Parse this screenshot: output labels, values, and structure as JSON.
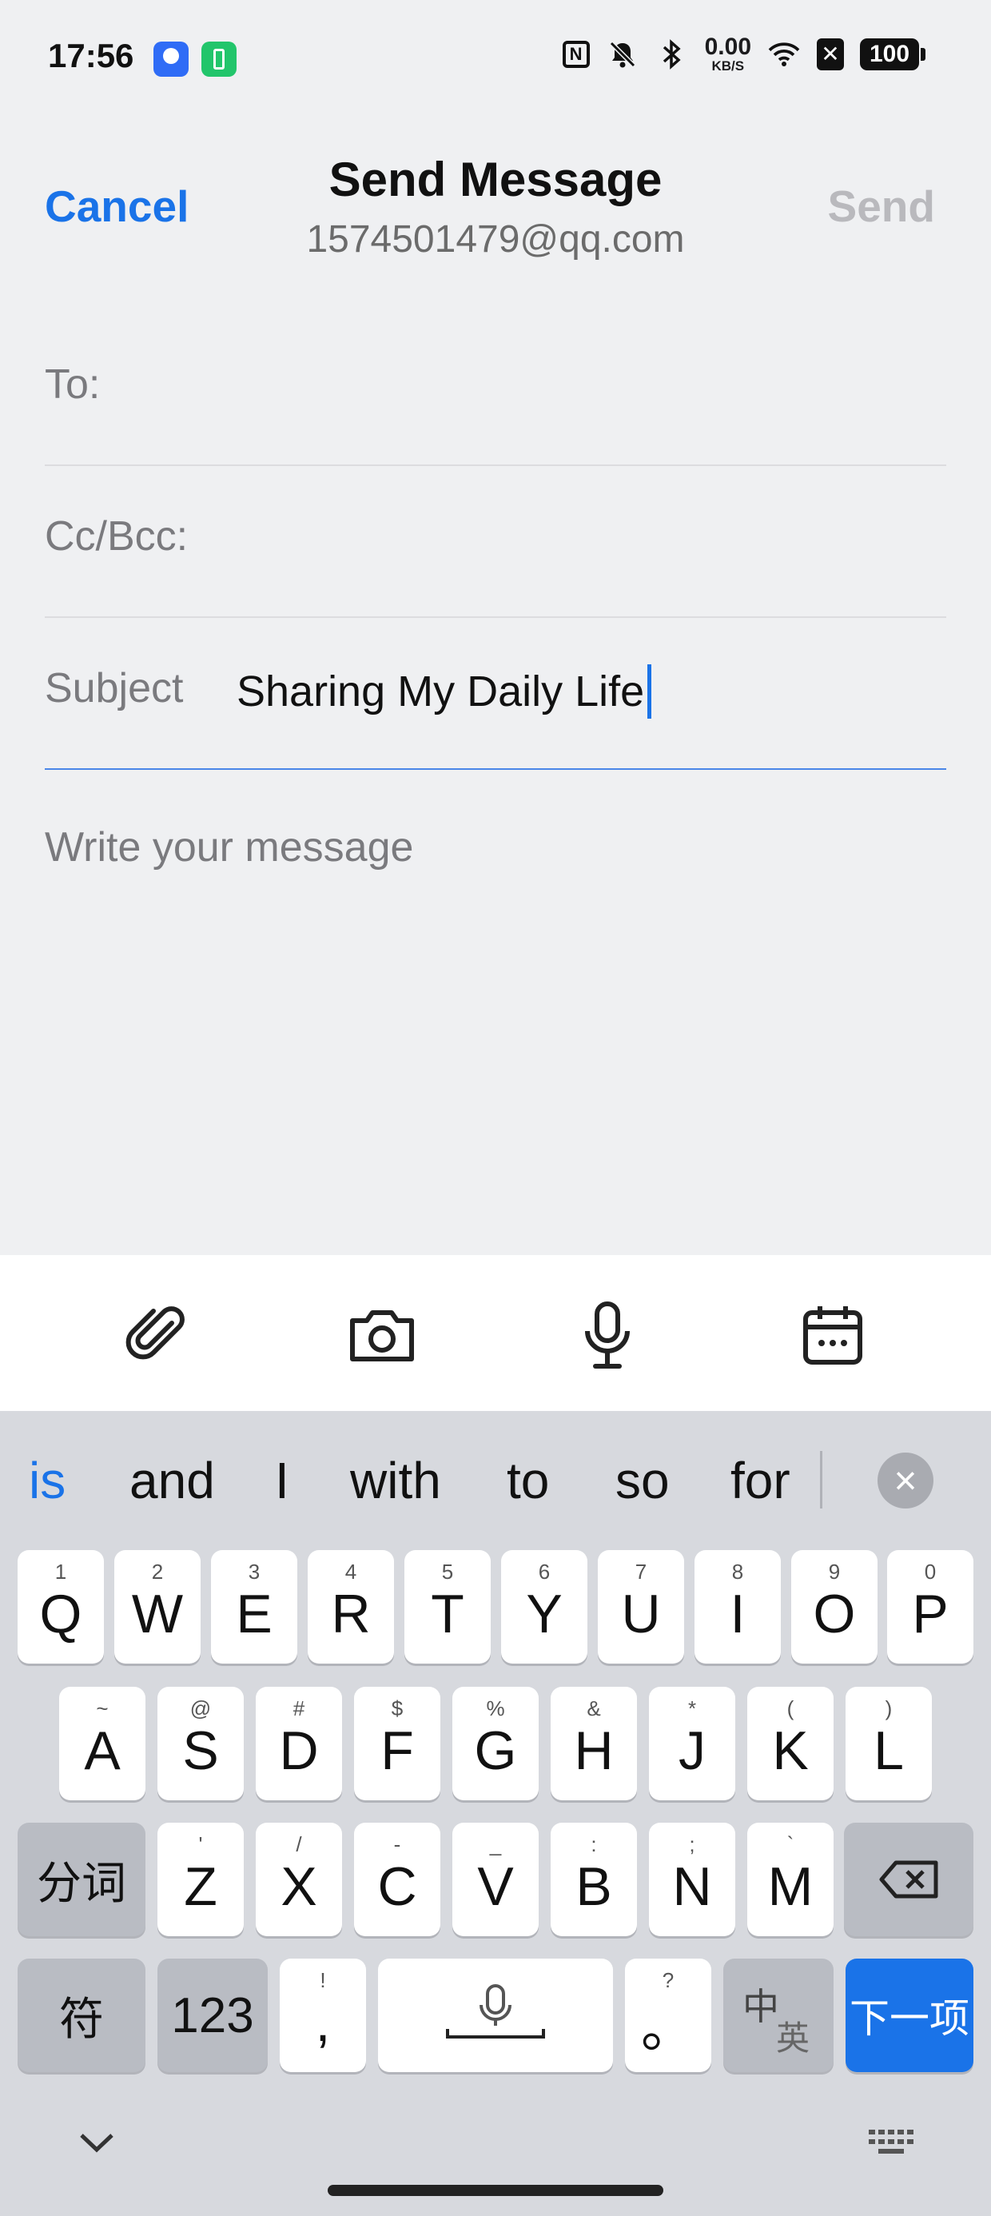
{
  "status_bar": {
    "time": "17:56",
    "net_speed_value": "0.00",
    "net_speed_unit": "KB/S",
    "battery": "100",
    "icons": [
      "nfc-icon",
      "mute-icon",
      "bluetooth-icon",
      "wifi-icon",
      "x-icon",
      "battery-icon"
    ]
  },
  "header": {
    "cancel": "Cancel",
    "title": "Send Message",
    "account": "1574501479@qq.com",
    "send": "Send"
  },
  "form": {
    "to_label": "To:",
    "to_value": "",
    "cc_label": "Cc/Bcc:",
    "cc_value": "",
    "subject_label": "Subject",
    "subject_value": "Sharing My Daily Life",
    "body_placeholder": "Write your message"
  },
  "toolbar": {
    "icons": [
      "paperclip-icon",
      "camera-icon",
      "microphone-icon",
      "calendar-icon"
    ]
  },
  "keyboard": {
    "suggestions": [
      "is",
      "and",
      "I",
      "with",
      "to",
      "so",
      "for"
    ],
    "row1": [
      {
        "k": "Q",
        "s": "1"
      },
      {
        "k": "W",
        "s": "2"
      },
      {
        "k": "E",
        "s": "3"
      },
      {
        "k": "R",
        "s": "4"
      },
      {
        "k": "T",
        "s": "5"
      },
      {
        "k": "Y",
        "s": "6"
      },
      {
        "k": "U",
        "s": "7"
      },
      {
        "k": "I",
        "s": "8"
      },
      {
        "k": "O",
        "s": "9"
      },
      {
        "k": "P",
        "s": "0"
      }
    ],
    "row2": [
      {
        "k": "A",
        "s": "~"
      },
      {
        "k": "S",
        "s": "@"
      },
      {
        "k": "D",
        "s": "#"
      },
      {
        "k": "F",
        "s": "$"
      },
      {
        "k": "G",
        "s": "%"
      },
      {
        "k": "H",
        "s": "&"
      },
      {
        "k": "J",
        "s": "*"
      },
      {
        "k": "K",
        "s": "("
      },
      {
        "k": "L",
        "s": ")"
      }
    ],
    "row3": [
      {
        "k": "Z",
        "s": "'"
      },
      {
        "k": "X",
        "s": "/"
      },
      {
        "k": "C",
        "s": "-"
      },
      {
        "k": "V",
        "s": "_"
      },
      {
        "k": "B",
        "s": ":"
      },
      {
        "k": "N",
        "s": ";"
      },
      {
        "k": "M",
        "s": "`"
      }
    ],
    "fenci": "分词",
    "fu": "符",
    "num": "123",
    "comma": ",",
    "comma_sub": "!",
    "period": "。",
    "period_sub": "?",
    "zh": "中",
    "en": "英",
    "next": "下一项"
  },
  "colors": {
    "accent": "#1a73e8",
    "background": "#eff0f2",
    "keyboard_bg": "#d7d9de"
  }
}
